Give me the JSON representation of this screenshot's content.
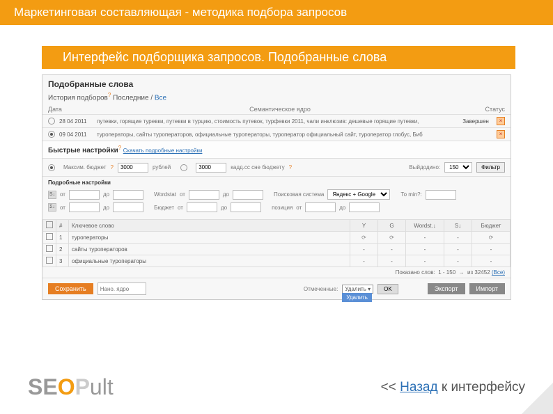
{
  "header": {
    "title": "Маркетинговая составляющая - методика подбора запросов"
  },
  "subheader": {
    "title": "Интерфейс подборщика запросов. Подобранные слова"
  },
  "panel": {
    "title": "Подобранные слова",
    "history_label": "История подборов",
    "last_label": "Последние",
    "all_label": "Все",
    "cols": {
      "date": "Дата",
      "core": "Семантическое ядро",
      "status": "Статус"
    },
    "rows": [
      {
        "date": "28 04 2011",
        "text": "путевки, горящие туревки, путевки в турцию, стоимость путевок, турфевки 2011, чали инклюзив: дешевые горящие путевки,",
        "status": "Завершен",
        "selected": false
      },
      {
        "date": "09 04 2011",
        "text": "туроператоры, сайты туроператоров, официальные туроператоры, туроператор официальный сайт, туроператор глобус, Биб",
        "status": "",
        "selected": true
      }
    ],
    "quick_title": "Быстрые настройки",
    "quick_more": "Скачать подробные настройки",
    "budget_label": "Максим. бюджет",
    "budget_value": "3000",
    "budget_unit": "рублей",
    "budget_alt": "3000",
    "budget_alt_label": "кадд.сс сне бюджету",
    "output_label": "Выйдодино:",
    "output_value": "150",
    "filter_btn": "Фильтр",
    "detail_title": "Подробные настройки",
    "d_from": "от",
    "d_to": "до",
    "d_wordstat": "Wordstat",
    "d_search": "Поисковая система",
    "d_engine": "Яндекс + Google",
    "d_tomin": "То min?:",
    "d_budget": "Бюджет",
    "d_pos": "позиция",
    "tbl_h": {
      "n": "#",
      "kw": "Ключевое слово",
      "y": "Y",
      "g": "G",
      "ws": "Wordst.↓",
      "s": "S↓",
      "b": "Бюджет"
    },
    "tbl_rows": [
      {
        "n": "1",
        "kw": "туроператоры"
      },
      {
        "n": "2",
        "kw": "сайты туроператоров"
      },
      {
        "n": "3",
        "kw": "официальные туроператоры"
      }
    ],
    "pagination": {
      "shown": "Показано слов:",
      "range": "1 - 150",
      "total": "из 32452",
      "all": "(Все)"
    },
    "footer": {
      "save": "Сохранить",
      "clear": "Нано. ядро",
      "marked": "Отмеченные:",
      "del": "Удалить",
      "del_menu": "Удалить",
      "ok": "OK",
      "export": "Экспорт",
      "import": "Импорт"
    }
  },
  "back": {
    "arrows": "<< ",
    "link": "Назад",
    "suffix": " к интерфейсу"
  },
  "logo": {
    "p1": "SE",
    "p2": "O",
    "p3": "P",
    "p4": "ult"
  }
}
